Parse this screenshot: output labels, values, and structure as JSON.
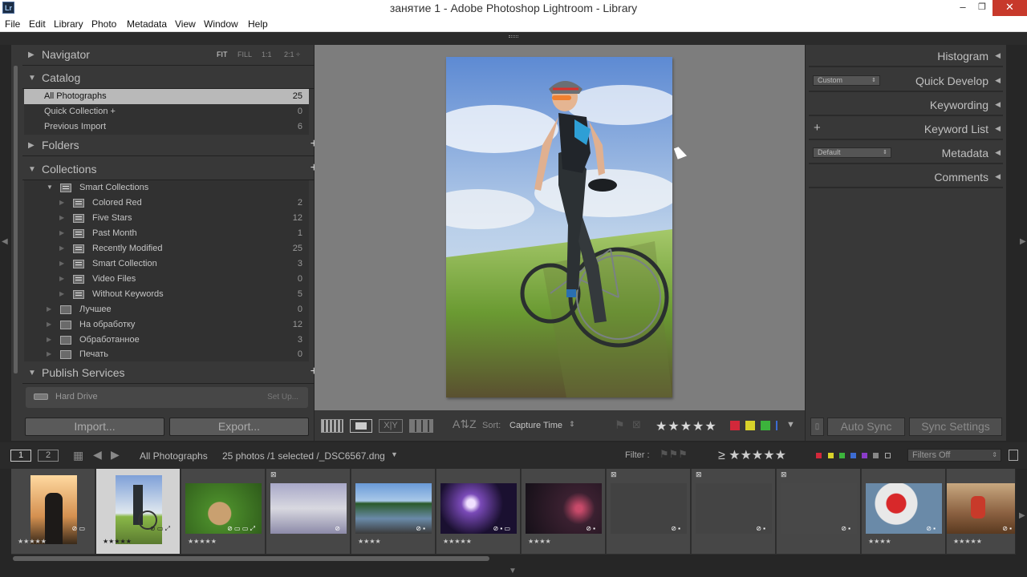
{
  "window": {
    "app_icon": "Lr",
    "title": "занятие 1 - Adobe Photoshop Lightroom - Library",
    "min": "–",
    "max": "❐",
    "close": "✕"
  },
  "menu": [
    "File",
    "Edit",
    "Library",
    "Photo",
    "Metadata",
    "View",
    "Window",
    "Help"
  ],
  "navigator": {
    "title": "Navigator",
    "options": [
      "FIT",
      "FILL",
      "1:1",
      "2:1 ÷"
    ]
  },
  "catalog": {
    "title": "Catalog",
    "items": [
      {
        "label": "All Photographs",
        "count": "25"
      },
      {
        "label": "Quick Collection  +",
        "count": "0"
      },
      {
        "label": "Previous Import",
        "count": "6"
      }
    ]
  },
  "folders": {
    "title": "Folders",
    "plus": "+"
  },
  "collections": {
    "title": "Collections",
    "plus": "+",
    "smart_set": "Smart Collections",
    "smart": [
      {
        "label": "Colored Red",
        "count": "2"
      },
      {
        "label": "Five Stars",
        "count": "12"
      },
      {
        "label": "Past Month",
        "count": "1"
      },
      {
        "label": "Recently Modified",
        "count": "25"
      },
      {
        "label": "Smart Collection",
        "count": "3"
      },
      {
        "label": "Video Files",
        "count": "0"
      },
      {
        "label": "Without Keywords",
        "count": "5"
      }
    ],
    "sets": [
      {
        "label": "Лучшее",
        "count": "0"
      },
      {
        "label": "На обработку",
        "count": "12"
      },
      {
        "label": "Обработанное",
        "count": "3"
      },
      {
        "label": "Печать",
        "count": "0"
      }
    ]
  },
  "publish": {
    "title": "Publish Services",
    "plus": "+",
    "service": "Hard Drive",
    "setup": "Set Up..."
  },
  "buttons": {
    "import": "Import...",
    "export": "Export..."
  },
  "toolbar": {
    "sort_label": "Sort:",
    "sort_value": "Capture Time",
    "stars": "★★★★★"
  },
  "right": {
    "histogram": "Histogram",
    "quick_develop": "Quick Develop",
    "qd_preset": "Custom",
    "keywording": "Keywording",
    "keyword_list": "Keyword List",
    "metadata": "Metadata",
    "meta_preset": "Default",
    "comments": "Comments",
    "auto_sync": "Auto Sync",
    "sync_settings": "Sync Settings"
  },
  "filmbar": {
    "page1": "1",
    "page2": "2",
    "source": "All Photographs",
    "info": "25 photos /1 selected /_DSC6567.dng",
    "filter_label": "Filter :",
    "filter_rating": "≥ ★★★★★",
    "filter_preset": "Filters Off"
  },
  "thumbs": [
    {
      "stars": "★★★★★",
      "badges": "⊘ ▭"
    },
    {
      "stars": "★★★★★",
      "badges": "⊘ ▭ ⤢"
    },
    {
      "stars": "★★★★★",
      "badges": "⊘ ▭ ▭ ⤢"
    },
    {
      "stars": "",
      "badges": "⊘"
    },
    {
      "stars": "★★★★",
      "badges": "⊘ ▪"
    },
    {
      "stars": "★★★★★",
      "badges": "⊘ ▪ ▭"
    },
    {
      "stars": "★★★★",
      "badges": "⊘ ▪"
    },
    {
      "stars": "",
      "badges": "⊘ ▪"
    },
    {
      "stars": "",
      "badges": "⊘ ▪"
    },
    {
      "stars": "",
      "badges": "⊘ ▪"
    },
    {
      "stars": "★★★★",
      "badges": "⊘ ▪"
    },
    {
      "stars": "★★★★★",
      "badges": "⊘ ▪"
    }
  ],
  "colors": {
    "accent_red": "#d2283a",
    "accent_yellow": "#d8d22a",
    "accent_green": "#3cb43c",
    "selected_row": "#b9b9b9"
  }
}
